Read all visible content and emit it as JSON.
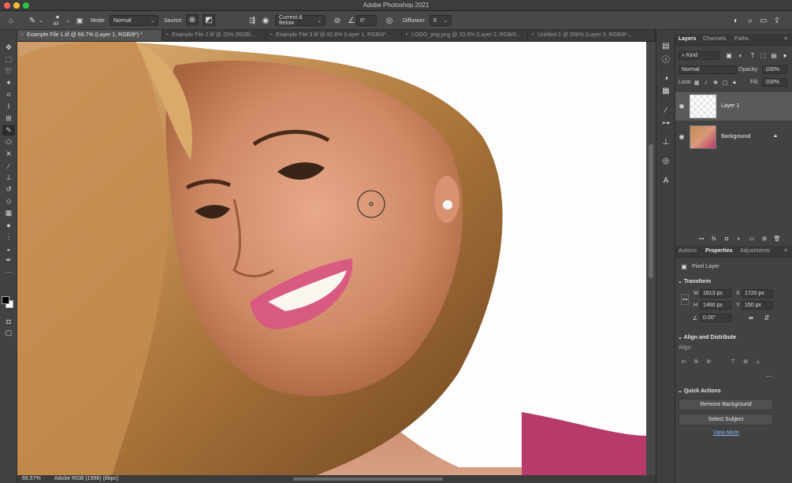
{
  "app": {
    "title": "Adobe Photoshop 2021"
  },
  "options": {
    "brush_size": "60",
    "mode_label": "Mode:",
    "mode_value": "Normal",
    "source_label": "Source:",
    "sample_value": "Current & Below",
    "angle_value": "0°",
    "diffusion_label": "Diffusion:",
    "diffusion_value": "5"
  },
  "tabs": [
    {
      "label": "Example File 1.tif @ 66.7% (Layer 1, RGB/8*) *",
      "active": true
    },
    {
      "label": "Example File 2.tif @ 25% (RGB/...",
      "active": false
    },
    {
      "label": "Example File 3.tif @ 82.6% (Layer 1, RGB/8*...",
      "active": false
    },
    {
      "label": "LOGO_png.png @ 33.3% (Layer 2, RGB/8...",
      "active": false
    },
    {
      "label": "Untitled-1 @ 306% (Layer 3, RGB/8*...",
      "active": false
    }
  ],
  "layers_panel": {
    "tabs": [
      "Layers",
      "Channels",
      "Paths"
    ],
    "filter_kind": "Kind",
    "blend_mode": "Normal",
    "opacity_label": "Opacity:",
    "opacity_value": "100%",
    "lock_label": "Lock:",
    "fill_label": "Fill:",
    "fill_value": "100%",
    "layers": [
      {
        "name": "Layer 1"
      },
      {
        "name": "Background"
      }
    ]
  },
  "properties_panel": {
    "tabs": [
      "Actions",
      "Properties",
      "Adjustments"
    ],
    "kind": "Pixel Layer",
    "transform_title": "Transform",
    "w_label": "W",
    "w_value": "1613 px",
    "h_label": "H",
    "h_value": "1460 px",
    "x_label": "X",
    "x_value": "1720 px",
    "y_label": "Y",
    "y_value": "150 px",
    "angle_value": "0.00°",
    "align_title": "Align and Distribute",
    "align_label": "Align:",
    "quick_title": "Quick Actions",
    "remove_bg": "Remove Background",
    "select_subject": "Select Subject",
    "view_more": "View More"
  },
  "status": {
    "zoom": "66.67%",
    "profile": "Adobe RGB (1998) (8bpc)"
  },
  "colors": {
    "accent": "#1473e6",
    "panel": "#424242",
    "canvas_bg": "#fdfdfd"
  }
}
